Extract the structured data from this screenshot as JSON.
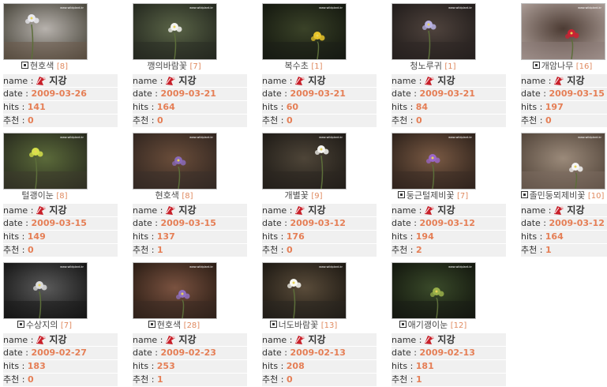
{
  "labels": {
    "name": "name :",
    "date": "date :",
    "hits": "hits :",
    "recommend": "추천 :"
  },
  "watermark": "www.wildplant.kr",
  "items": [
    {
      "title": "현호색",
      "count": "[8]",
      "name": "지강",
      "date": "2009-03-26",
      "hits": "141",
      "recommend": "0",
      "has_icon": true,
      "photo_colors": [
        "#6b5a4a",
        "#b7b2ad",
        "#3d3a2f"
      ],
      "flower": "#eaeaf0"
    },
    {
      "title": "깽의바람꽃",
      "count": "[7]",
      "name": "지강",
      "date": "2009-03-21",
      "hits": "164",
      "recommend": "0",
      "has_icon": false,
      "photo_colors": [
        "#2a2e24",
        "#5a6447",
        "#1d201a"
      ],
      "flower": "#f4f4f0"
    },
    {
      "title": "복수초",
      "count": "[1]",
      "name": "지강",
      "date": "2009-03-21",
      "hits": "60",
      "recommend": "0",
      "has_icon": false,
      "photo_colors": [
        "#1c1f18",
        "#3a4228",
        "#0f120c"
      ],
      "flower": "#e8c42a"
    },
    {
      "title": "청노루귀",
      "count": "[1]",
      "name": "지강",
      "date": "2009-03-21",
      "hits": "84",
      "recommend": "0",
      "has_icon": false,
      "photo_colors": [
        "#2d2624",
        "#4f433d",
        "#1b1716"
      ],
      "flower": "#b9b3e4"
    },
    {
      "title": "개암나무",
      "count": "[16]",
      "name": "지강",
      "date": "2009-03-15",
      "hits": "197",
      "recommend": "0",
      "has_icon": true,
      "photo_colors": [
        "#8a7a76",
        "#4c3b33",
        "#b6a8a2"
      ],
      "flower": "#cc2233"
    },
    {
      "title": "털괭이눈",
      "count": "[8]",
      "name": "지강",
      "date": "2009-03-15",
      "hits": "149",
      "recommend": "0",
      "has_icon": false,
      "photo_colors": [
        "#3d3a2c",
        "#5b6a3a",
        "#22231b"
      ],
      "flower": "#d6e04a"
    },
    {
      "title": "현호색",
      "count": "[8]",
      "name": "지강",
      "date": "2009-03-15",
      "hits": "137",
      "recommend": "1",
      "has_icon": false,
      "photo_colors": [
        "#3b302a",
        "#6a4d3a",
        "#2a211d"
      ],
      "flower": "#8a6ab8"
    },
    {
      "title": "개별꽃",
      "count": "[9]",
      "name": "지강",
      "date": "2009-03-12",
      "hits": "176",
      "recommend": "0",
      "has_icon": false,
      "photo_colors": [
        "#2c2721",
        "#4e4538",
        "#181512"
      ],
      "flower": "#f6f6f2"
    },
    {
      "title": "둥근털제비꽃",
      "count": "[7]",
      "name": "지강",
      "date": "2009-03-12",
      "hits": "194",
      "recommend": "2",
      "has_icon": true,
      "photo_colors": [
        "#3a2c24",
        "#7a5a44",
        "#231a15"
      ],
      "flower": "#9a66c8"
    },
    {
      "title": "졸민둥뫼제비꽃",
      "count": "[10]",
      "name": "지강",
      "date": "2009-03-12",
      "hits": "164",
      "recommend": "1",
      "has_icon": true,
      "photo_colors": [
        "#7a6a5e",
        "#9b8a7a",
        "#4a3d33"
      ],
      "flower": "#f6f6f6"
    },
    {
      "title": "수상지의",
      "count": "[7]",
      "name": "지강",
      "date": "2009-02-27",
      "hits": "183",
      "recommend": "0",
      "has_icon": true,
      "photo_colors": [
        "#1c1c1c",
        "#5a5a5a",
        "#0c0c0c"
      ],
      "flower": "#dcdcdc"
    },
    {
      "title": "현호색",
      "count": "[28]",
      "name": "지강",
      "date": "2009-02-23",
      "hits": "253",
      "recommend": "1",
      "has_icon": true,
      "photo_colors": [
        "#3a2a22",
        "#7a5240",
        "#20160f"
      ],
      "flower": "#9070c0"
    },
    {
      "title": "너도바람꽃",
      "count": "[13]",
      "name": "지강",
      "date": "2009-02-13",
      "hits": "208",
      "recommend": "0",
      "has_icon": true,
      "photo_colors": [
        "#2a2620",
        "#5a4c3a",
        "#14110d"
      ],
      "flower": "#f8f8f2"
    },
    {
      "title": "애기괭이눈",
      "count": "[12]",
      "name": "지강",
      "date": "2009-02-13",
      "hits": "181",
      "recommend": "1",
      "has_icon": true,
      "photo_colors": [
        "#1a1d16",
        "#3a4a2a",
        "#0d0f0a"
      ],
      "flower": "#9ab04a"
    }
  ]
}
